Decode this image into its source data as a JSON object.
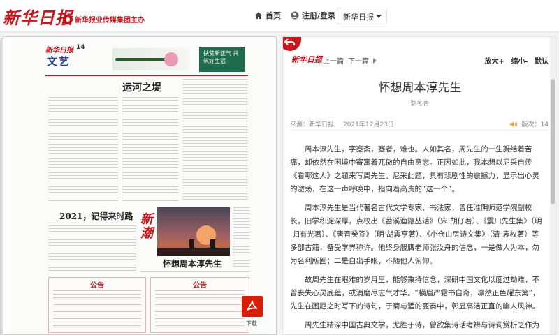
{
  "header": {
    "logo": "新华日报",
    "group_name": "新华报业传媒集团主办",
    "nav": {
      "home": "首页",
      "login": "注册/登录"
    },
    "paper_select": "新华日报"
  },
  "paper_page": {
    "masthead_logo": "新华日报",
    "page_number": "14",
    "column": "文艺",
    "ad_text": "扶贫新正气 共筑好生活",
    "headline_1": "运河之堤",
    "headline_2": "2021，记得来时路",
    "headline_3": "怀想周本淳先生",
    "column_brush": "新潮",
    "notice_left": "公告",
    "notice_right": "公告",
    "download_label": "下载"
  },
  "article": {
    "logo": "新华日报",
    "prev": "上一篇",
    "next": "下一篇",
    "zoom_in": "放大+",
    "zoom_out": "缩小-",
    "reset": "默认",
    "title": "怀想周本淳先生",
    "author": "骆冬青",
    "source": "来源：新华日报",
    "date": "2021年12月23日",
    "edition": "版次：14",
    "paragraphs": [
      "周本淳先生，字蹇斋，蹇者，难也。人如其名，周先生的一生凝结着苦痛，却依然在困境中寄寓着兀傲的自由意志。正因如此，我本想以尼采自传《看哪这人》之题来写周先生。尼采此题，具有悲剧性的震撼力，显示出心灵的激荡，在这一声呼唤中，指向着高贵的“这一个”。",
      "周本淳先生是当代著名古代文学专家、书法家，曾任淮阴师范学院副校长，旧学积淀深厚，点校出《苕溪渔隐丛话》（宋·胡仔著）、《震川先生集》（明·归有光著）、《唐音癸签》（明·胡震亨著）、《小仓山房诗文集》（清·袁枚著）等多部古籍，备受学界称许。他终身服膺老师张汝舟的信念，一是做人为本，勿为名利所囿；二是自出手眼，不随他人俯仰。",
      "故周先生在艰难的岁月里，能够秉持信念，深研中国文化以度过劫难，不曾丧失心灵底蕴，或消磨尽志气才华。“横眉严霜书自奇，凛然正色耀东篱”，先生在困厄之时写下的诗句，于菊与酒的变奏中，彰显高洁正直的幽人风神。",
      "周先生精深中国古典文学，尤胜于诗，曾欲集诗话考辨与诗词赏析之作为《蹇"
    ]
  },
  "colors": {
    "brand_red": "#c8161d",
    "link_blue": "#1a3c8c"
  },
  "icons": [
    "home-icon",
    "user-icon",
    "chevron-down-icon",
    "back-arrow-icon",
    "pdf-icon",
    "speaker-icon"
  ]
}
